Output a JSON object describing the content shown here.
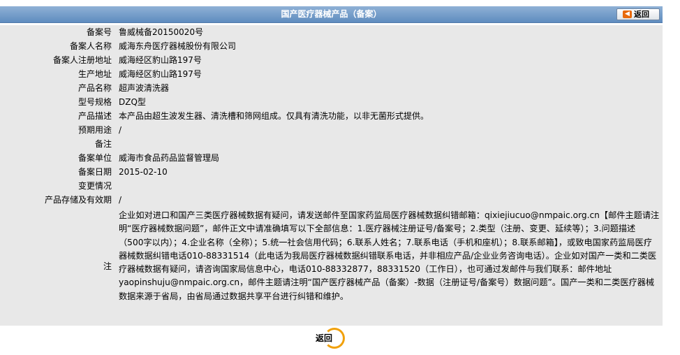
{
  "header": {
    "title": "国产医疗器械产品（备案）",
    "back_label": "返回",
    "back_icon": "back-arrow-icon"
  },
  "rows": [
    {
      "label": "备案号",
      "value": "鲁威械备20150020号"
    },
    {
      "label": "备案人名称",
      "value": "威海东舟医疗器械股份有限公司"
    },
    {
      "label": "备案人注册地址",
      "value": "威海经区豹山路197号"
    },
    {
      "label": "生产地址",
      "value": "威海经区豹山路197号"
    },
    {
      "label": "产品名称",
      "value": "超声波清洗器"
    },
    {
      "label": "型号规格",
      "value": "DZQ型"
    },
    {
      "label": "产品描述",
      "value": "本产品由超生波发生器、清洗槽和筛网组成。仅具有清洗功能，以非无菌形式提供。"
    },
    {
      "label": "预期用途",
      "value": "/"
    },
    {
      "label": "备注",
      "value": ""
    },
    {
      "label": "备案单位",
      "value": "威海市食品药品监督管理局"
    },
    {
      "label": "备案日期",
      "value": "2015-02-10"
    },
    {
      "label": "变更情况",
      "value": ""
    },
    {
      "label": "产品存储及有效期",
      "value": "/"
    }
  ],
  "note": {
    "label": "注",
    "text": "企业如对进口和国产三类医疗器械数据有疑问，请发送邮件至国家药监局医疗器械数据纠错邮箱：qixiejiucuo@nmpaic.org.cn【邮件主题请注明“医疗器械数据问题”，邮件正文中请准确填写以下全部信息：1.医疗器械注册证号/备案号；2.类型（注册、变更、延续等）；3.问题描述（500字以内）；4.企业名称（全称）；5.统一社会信用代码；6.联系人姓名；7.联系电话（手机和座机）；8.联系邮箱】，或致电国家药监局医疗器械数据纠错电话010-88331514（此电话为我局医疗器械数据纠错联系电话，并非相应产品/企业业务咨询电话）。企业如对国产一类和二类医疗器械数据有疑问，请咨询国家局信息中心，电话010-88332877，88331520（工作日），也可通过发邮件与我们联系：邮件地址yaopinshuju@nmpaic.org.cn，邮件主题请注明“国产医疗器械产品（备案）-数据（注册证号/备案号）数据问题”。国产一类和二类医疗器械数据来源于省局，由省局通过数据共享平台进行纠错和维护。"
  },
  "footer": {
    "back_label": "返回"
  },
  "colors": {
    "header_top": "#8fb1d6",
    "header_bottom": "#5f8cbf",
    "row_bg": "#e8e8e8",
    "accent": "#f1a10c"
  }
}
